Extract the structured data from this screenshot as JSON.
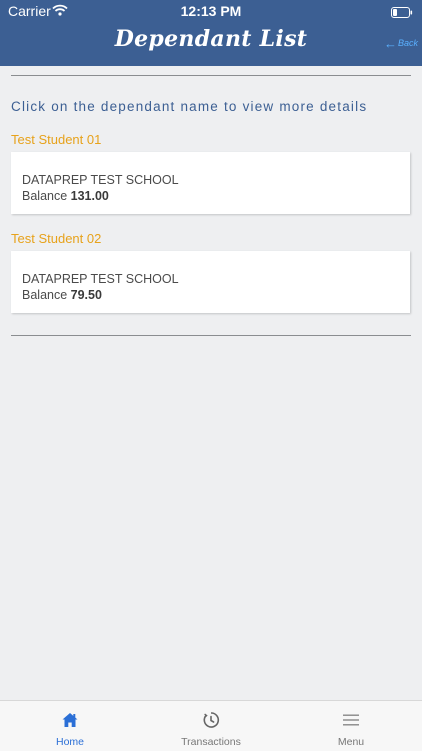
{
  "status_bar": {
    "carrier": "Carrier",
    "time": "12:13 PM"
  },
  "nav": {
    "title": "Dependant List",
    "back_label": "Back"
  },
  "instruction": "Click on the dependant name to view more details",
  "dependants": [
    {
      "name": "Test Student 01",
      "school": "DATAPREP TEST SCHOOL",
      "balance_label": "Balance",
      "balance": "131.00"
    },
    {
      "name": "Test Student 02",
      "school": "DATAPREP TEST SCHOOL",
      "balance_label": "Balance",
      "balance": "79.50"
    }
  ],
  "tabs": [
    {
      "label": "Home",
      "icon": "home-icon",
      "active": true
    },
    {
      "label": "Transactions",
      "icon": "history-icon",
      "active": false
    },
    {
      "label": "Menu",
      "icon": "menu-icon",
      "active": false
    }
  ],
  "colors": {
    "header": "#3c5f93",
    "accent": "#e7a21b",
    "active_tab": "#2b6fd6"
  }
}
